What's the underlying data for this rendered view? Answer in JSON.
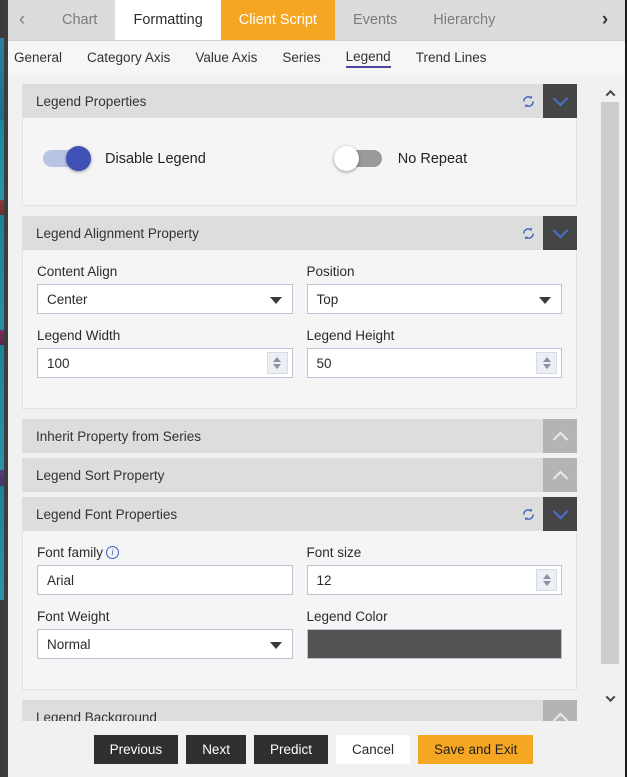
{
  "tabbar": {
    "prev_icon": "chevron-left-icon",
    "next_icon": "chevron-right-icon",
    "tabs": [
      {
        "label": "Chart",
        "state": "normal"
      },
      {
        "label": "Formatting",
        "state": "active"
      },
      {
        "label": "Client Script",
        "state": "highlight"
      },
      {
        "label": "Events",
        "state": "normal"
      },
      {
        "label": "Hierarchy",
        "state": "normal"
      }
    ]
  },
  "subtabs": [
    {
      "label": "General",
      "active": false
    },
    {
      "label": "Category Axis",
      "active": false
    },
    {
      "label": "Value Axis",
      "active": false
    },
    {
      "label": "Series",
      "active": false
    },
    {
      "label": "Legend",
      "active": true
    },
    {
      "label": "Trend Lines",
      "active": false
    }
  ],
  "sections": {
    "legend_properties": {
      "title": "Legend Properties",
      "refresh_icon": "refresh-icon",
      "chevron_icon": "chevron-down-icon",
      "toggles": [
        {
          "label": "Disable Legend",
          "state": "on"
        },
        {
          "label": "No Repeat",
          "state": "off"
        }
      ]
    },
    "legend_alignment": {
      "title": "Legend Alignment Property",
      "refresh_icon": "refresh-icon",
      "chevron_icon": "chevron-down-icon",
      "content_align": {
        "label": "Content Align",
        "value": "Center"
      },
      "position": {
        "label": "Position",
        "value": "Top"
      },
      "legend_width": {
        "label": "Legend Width",
        "value": "100"
      },
      "legend_height": {
        "label": "Legend Height",
        "value": "50"
      }
    },
    "inherit_property": {
      "title": "Inherit Property from Series",
      "chevron_icon": "chevron-up-icon"
    },
    "legend_sort": {
      "title": "Legend Sort Property",
      "chevron_icon": "chevron-up-icon"
    },
    "legend_font": {
      "title": "Legend Font Properties",
      "refresh_icon": "refresh-icon",
      "chevron_icon": "chevron-down-icon",
      "font_family": {
        "label": "Font family",
        "value": "Arial",
        "info_icon": "info-icon"
      },
      "font_size": {
        "label": "Font size",
        "value": "12"
      },
      "font_weight": {
        "label": "Font Weight",
        "value": "Normal"
      },
      "legend_color": {
        "label": "Legend Color",
        "value": "#535353"
      }
    },
    "legend_background": {
      "title": "Legend Background",
      "chevron_icon": "chevron-up-icon"
    }
  },
  "scrollbar": {
    "up_icon": "scroll-up-arrow-icon",
    "down_icon": "scroll-down-arrow-icon"
  },
  "footer": {
    "previous": "Previous",
    "next": "Next",
    "predict": "Predict",
    "cancel": "Cancel",
    "save_and_exit": "Save and Exit"
  },
  "colors": {
    "accent": "#f5a623",
    "toggle_on": "#3f51b5",
    "chevron_blue": "#4a6fd1",
    "legend_color_swatch": "#535353"
  }
}
